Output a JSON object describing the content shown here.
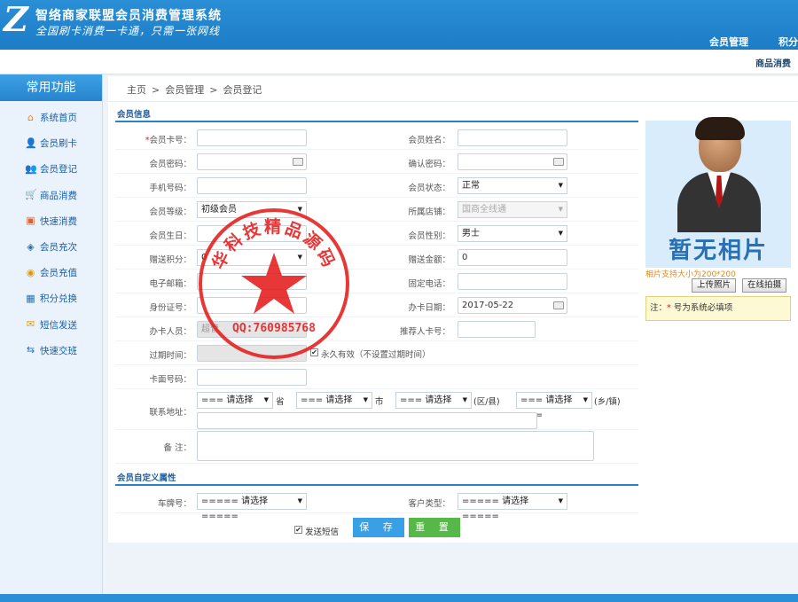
{
  "app": {
    "title": "智络商家联盟会员消费管理系统",
    "slogan": "全国刷卡消费一卡通，只需一张网线",
    "logo_letter": "Z",
    "top_nav": [
      "会员管理",
      "积分"
    ],
    "sub_nav": "商品消费"
  },
  "sidebar": {
    "title": "常用功能",
    "items": [
      {
        "label": "系统首页",
        "icon": "home-icon"
      },
      {
        "label": "会员刷卡",
        "icon": "member-swipe-icon"
      },
      {
        "label": "会员登记",
        "icon": "member-register-icon"
      },
      {
        "label": "商品消费",
        "icon": "cart-icon"
      },
      {
        "label": "快速消费",
        "icon": "quick-pay-icon"
      },
      {
        "label": "会员充次",
        "icon": "recharge-count-icon"
      },
      {
        "label": "会员充值",
        "icon": "recharge-icon"
      },
      {
        "label": "积分兑换",
        "icon": "points-icon"
      },
      {
        "label": "短信发送",
        "icon": "sms-icon"
      },
      {
        "label": "快速交班",
        "icon": "handover-icon"
      }
    ]
  },
  "breadcrumb": [
    "主页",
    "会员管理",
    "会员登记"
  ],
  "breadcrumb_sep": ">",
  "section_member_info": "会员信息",
  "section_custom": "会员自定义属性",
  "form": {
    "card_no": {
      "label": "会员卡号：",
      "value": ""
    },
    "name": {
      "label": "会员姓名：",
      "value": ""
    },
    "password": {
      "label": "会员密码：",
      "value": ""
    },
    "confirm_password": {
      "label": "确认密码：",
      "value": ""
    },
    "phone": {
      "label": "手机号码：",
      "value": ""
    },
    "status": {
      "label": "会员状态：",
      "value": "正常"
    },
    "level": {
      "label": "会员等级：",
      "value": "初级会员"
    },
    "store": {
      "label": "所属店铺：",
      "value": "国商全线通"
    },
    "birthday": {
      "label": "会员生日：",
      "value": ""
    },
    "gender": {
      "label": "会员性别：",
      "value": "男士"
    },
    "gift_points": {
      "label": "赠送积分：",
      "value": "0"
    },
    "gift_amount": {
      "label": "赠送金额：",
      "value": "0"
    },
    "email": {
      "label": "电子邮箱：",
      "value": ""
    },
    "landline": {
      "label": "固定电话：",
      "value": ""
    },
    "id_no": {
      "label": "身份证号：",
      "value": ""
    },
    "issue_date": {
      "label": "办卡日期：",
      "value": "2017-05-22"
    },
    "operator": {
      "label": "办卡人员：",
      "value": "超管"
    },
    "referrer": {
      "label": "推荐人卡号：",
      "value": ""
    },
    "expire": {
      "label": "过期时间：",
      "value": "",
      "permanent_label": "永久有效（不设置过期时间）"
    },
    "face_no": {
      "label": "卡面号码：",
      "value": ""
    },
    "address": {
      "label": "联系地址：",
      "province": "=== 请选择 ===",
      "province_suffix": "省",
      "city": "=== 请选择 ===",
      "city_suffix": "市",
      "district": "=== 请选择 ===",
      "district_suffix": "(区/县)",
      "town": "=== 请选择 ===",
      "town_suffix": "(乡/镇)",
      "detail": ""
    },
    "remark": {
      "label": "备 注：",
      "value": ""
    },
    "plate": {
      "label": "车牌号：",
      "value": "===== 请选择 ====="
    },
    "customer_type": {
      "label": "客户类型：",
      "value": "===== 请选择 ====="
    }
  },
  "photo": {
    "placeholder": "暂无相片",
    "note": "相片支持大小为200*200",
    "upload_button": "上传照片",
    "capture_button": "在线拍摄",
    "required_note_prefix": "注：",
    "required_note_star": "*",
    "required_note_text": " 号为系统必填项"
  },
  "actions": {
    "send_sms": "发送短信",
    "save": "保 存",
    "reset": "重 置"
  },
  "stamp": {
    "text": "华科技精品源码",
    "qq": "QQ:760985768"
  },
  "colors": {
    "accent": "#2a8fd6",
    "save": "#3aa0e6",
    "reset": "#57b84a",
    "stamp": "#e51c1c"
  }
}
